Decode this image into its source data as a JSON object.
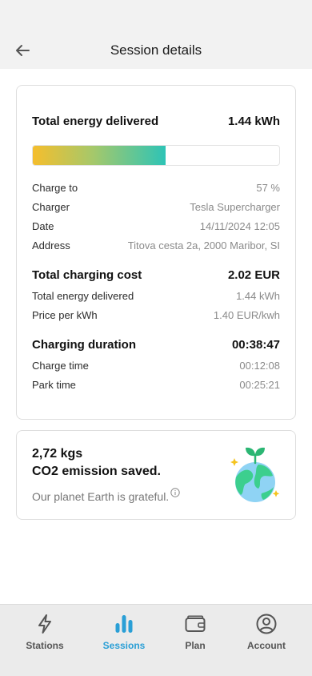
{
  "header": {
    "title": "Session details"
  },
  "energy": {
    "label": "Total energy delivered",
    "value": "1.44 kWh",
    "progress_fraction": 0.54
  },
  "details": [
    {
      "label": "Charge to",
      "value": "57 %"
    },
    {
      "label": "Charger",
      "value": "Tesla Supercharger"
    },
    {
      "label": "Date",
      "value": "14/11/2024 12:05"
    },
    {
      "label": "Address",
      "value": "Titova cesta 2a, 2000 Maribor, SI"
    }
  ],
  "cost": {
    "label": "Total charging cost",
    "value": "2.02 EUR",
    "items": [
      {
        "label": "Total energy delivered",
        "value": "1.44 kWh"
      },
      {
        "label": "Price per kWh",
        "value": "1.40 EUR/kwh"
      }
    ]
  },
  "duration": {
    "label": "Charging duration",
    "value": "00:38:47",
    "items": [
      {
        "label": "Charge time",
        "value": "00:12:08"
      },
      {
        "label": "Park time",
        "value": "00:25:21"
      }
    ]
  },
  "eco": {
    "amount": "2,72 kgs",
    "label": "CO2 emission saved.",
    "subtitle": "Our planet Earth is grateful.",
    "icon": "earth-sprout-icon"
  },
  "tabs": [
    {
      "label": "Stations",
      "icon": "lightning-icon",
      "active": false
    },
    {
      "label": "Sessions",
      "icon": "bar-chart-icon",
      "active": true
    },
    {
      "label": "Plan",
      "icon": "wallet-icon",
      "active": false
    },
    {
      "label": "Account",
      "icon": "user-circle-icon",
      "active": false
    }
  ],
  "colors": {
    "accent": "#2a9fd6",
    "gradient_start": "#f5be2d",
    "gradient_end": "#2ec4b6",
    "earth_land": "#3ccf8e",
    "earth_ocean": "#8fd3f4"
  }
}
